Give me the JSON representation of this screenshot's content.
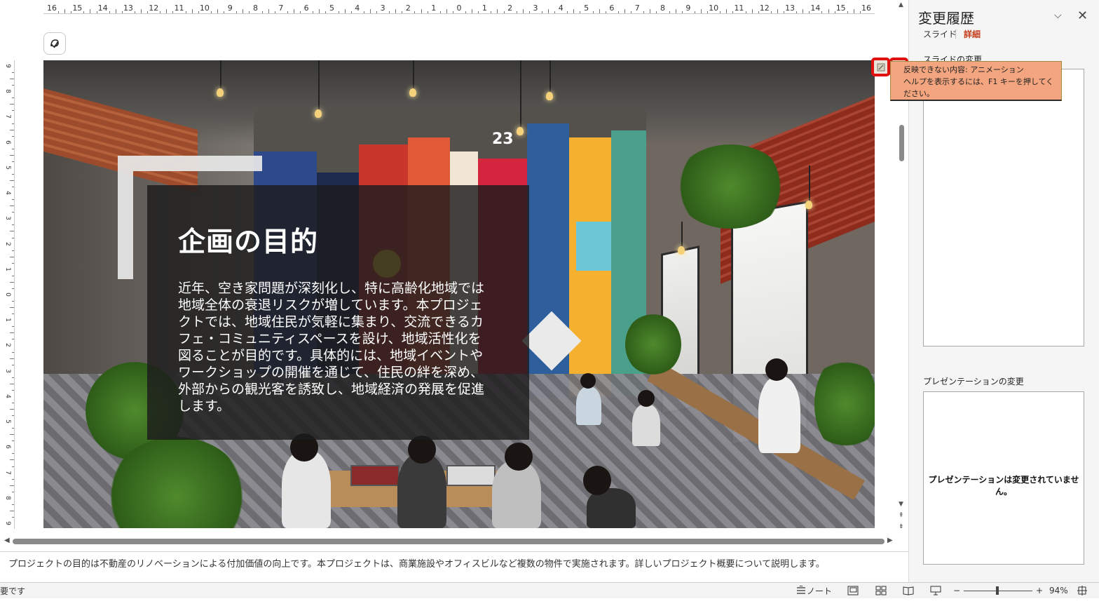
{
  "ruler": {
    "horizontal_labels": [
      "16",
      "15",
      "14",
      "13",
      "12",
      "11",
      "10",
      "9",
      "8",
      "7",
      "6",
      "5",
      "4",
      "3",
      "2",
      "1",
      "0",
      "1",
      "2",
      "3",
      "4",
      "5",
      "6",
      "7",
      "8",
      "9",
      "10",
      "11",
      "12",
      "13",
      "14",
      "15",
      "16"
    ],
    "vertical_labels": [
      "9",
      "8",
      "7",
      "6",
      "5",
      "4",
      "3",
      "2",
      "1",
      "0",
      "1",
      "2",
      "3",
      "4",
      "5",
      "6",
      "7",
      "8",
      "9"
    ]
  },
  "slide": {
    "title": "企画の目的",
    "body": "近年、空き家問題が深刻化し、特に高齢化地域では地域全体の衰退リスクが増しています。本プロジェクトでは、地域住民が気軽に集まり、交流できるカフェ・コミュニティスペースを設け、地域活性化を図ることが目的です。具体的には、地域イベントやワークショップの開催を通じて、住民の絆を深め、外部からの観光客を誘致し、地域経済の発展を促進します。",
    "mural_number": "23"
  },
  "notes": {
    "text": "プロジェクトの目的は不動産のリノベーションによる付加価値の向上です。本プロジェクトは、商業施設やオフィスビルなど複数の物件で実施されます。詳しいプロジェクト概要について説明します。"
  },
  "pane": {
    "title": "変更履歴",
    "tabs": {
      "slide": "スライド",
      "detail": "詳細"
    },
    "slide_changes_label": "スライドの変更",
    "presentation_changes_label": "プレゼンテーションの変更",
    "presentation_empty": "プレゼンテーションは変更されていません。"
  },
  "tooltip": {
    "line1": "反映できない内容: アニメーション",
    "line2": "ヘルプを表示するには、F1 キーを押してください。"
  },
  "status": {
    "left_text": "要です",
    "notes_label": "ノート",
    "zoom_minus": "−",
    "zoom_plus": "+",
    "zoom_level": "94%"
  },
  "colors": {
    "accent": "#c43e1c",
    "marker_border": "#e01010",
    "tooltip_bg": "#f2a57f",
    "panel_overlay": "#1c1c1c"
  },
  "icons": [
    "designer-icon",
    "collapse-chevron-icon",
    "close-icon",
    "notes-icon",
    "normal-view-icon",
    "slide-sorter-icon",
    "reading-view-icon",
    "slideshow-icon",
    "fit-to-window-icon",
    "change-marker-icon"
  ]
}
